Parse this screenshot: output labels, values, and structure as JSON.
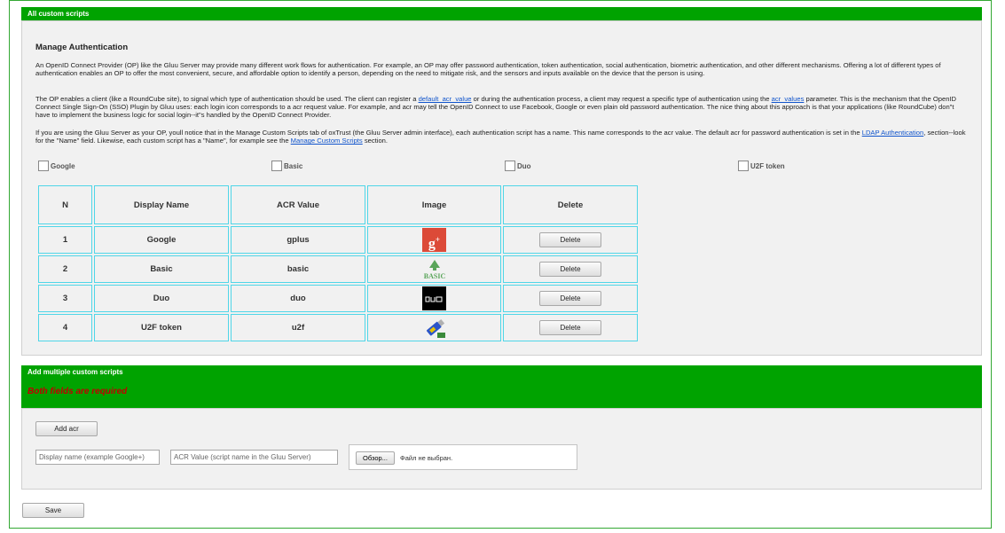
{
  "all_scripts": {
    "bar_title": "All custom scripts",
    "heading": "Manage Authentication",
    "p1": "An OpenID Connect Provider (OP) like the Gluu Server may provide many different work flows for authentication. For example, an OP may offer password authentication, token authentication, social authentication, biometric authentication, and other different mechanisms. Offering a lot of different types of authentication enables an OP to offer the most convenient, secure, and affordable option to identify a person, depending on the need to mitigate risk, and the sensors and inputs available on the device that the person is using.",
    "p2": {
      "t1": "The OP enables a client (like a RoundCube site), to signal which type of authentication should be used. The client can register a ",
      "link1": "default_acr_value",
      "t2": " or during the authentication process, a client may request a specific type of authentication using the ",
      "link2": "acr_values",
      "t3": " parameter. This is the mechanism that the OpenID Connect Single Sign-On (SSO) Plugin by Gluu uses: each login icon corresponds to a acr request value. For example, and acr may tell the OpenID Connect to use Facebook, Google or even plain old password authentication. The nice thing about this approach is that your applications (like RoundCube) don\"t have to implement the business logic for social login--it\"s handled by the OpenID Connect Provider."
    },
    "p3": {
      "t1": "If you are using the Gluu Server as your OP, youll notice that in the Manage Custom Scripts tab of oxTrust (the Gluu Server admin interface), each authentication script has a name. This name corresponds to the acr value. The default acr for password authentication is set in the ",
      "link1": "LDAP Authentication",
      "t2": ", section--look for the \"Name\" field. Likewise, each custom script has a \"Name\", for example see the ",
      "link2": "Manage Custom Scripts",
      "t3": " section."
    },
    "checkboxes": [
      "Google",
      "Basic",
      "Duo",
      "U2F token"
    ],
    "table": {
      "headers": [
        "N",
        "Display Name",
        "ACR Value",
        "Image",
        "Delete"
      ],
      "rows": [
        {
          "n": "1",
          "name": "Google",
          "acr": "gplus",
          "icon": "google-plus-icon",
          "delete": "Delete"
        },
        {
          "n": "2",
          "name": "Basic",
          "acr": "basic",
          "icon": "basic-icon",
          "delete": "Delete"
        },
        {
          "n": "3",
          "name": "Duo",
          "acr": "duo",
          "icon": "duo-icon",
          "delete": "Delete"
        },
        {
          "n": "4",
          "name": "U2F token",
          "acr": "u2f",
          "icon": "usb-key-icon",
          "delete": "Delete"
        }
      ]
    }
  },
  "add_scripts": {
    "bar_title": "Add multiple custom scripts",
    "warning": "Both fields are required",
    "add_button": "Add acr",
    "display_name_placeholder": "Display name (example Google+)",
    "acr_value_placeholder": "ACR Value (script name in the Gluu Server)",
    "file_button": "Обзор...",
    "file_status": "Файл не выбран."
  },
  "save_button": "Save",
  "colors": {
    "bar_green": "#00a300",
    "cell_border": "#4fd6e8",
    "warning_red": "#c00000",
    "link_blue": "#1155cc",
    "google_red": "#dc4a38",
    "basic_green": "#5aa55a"
  }
}
